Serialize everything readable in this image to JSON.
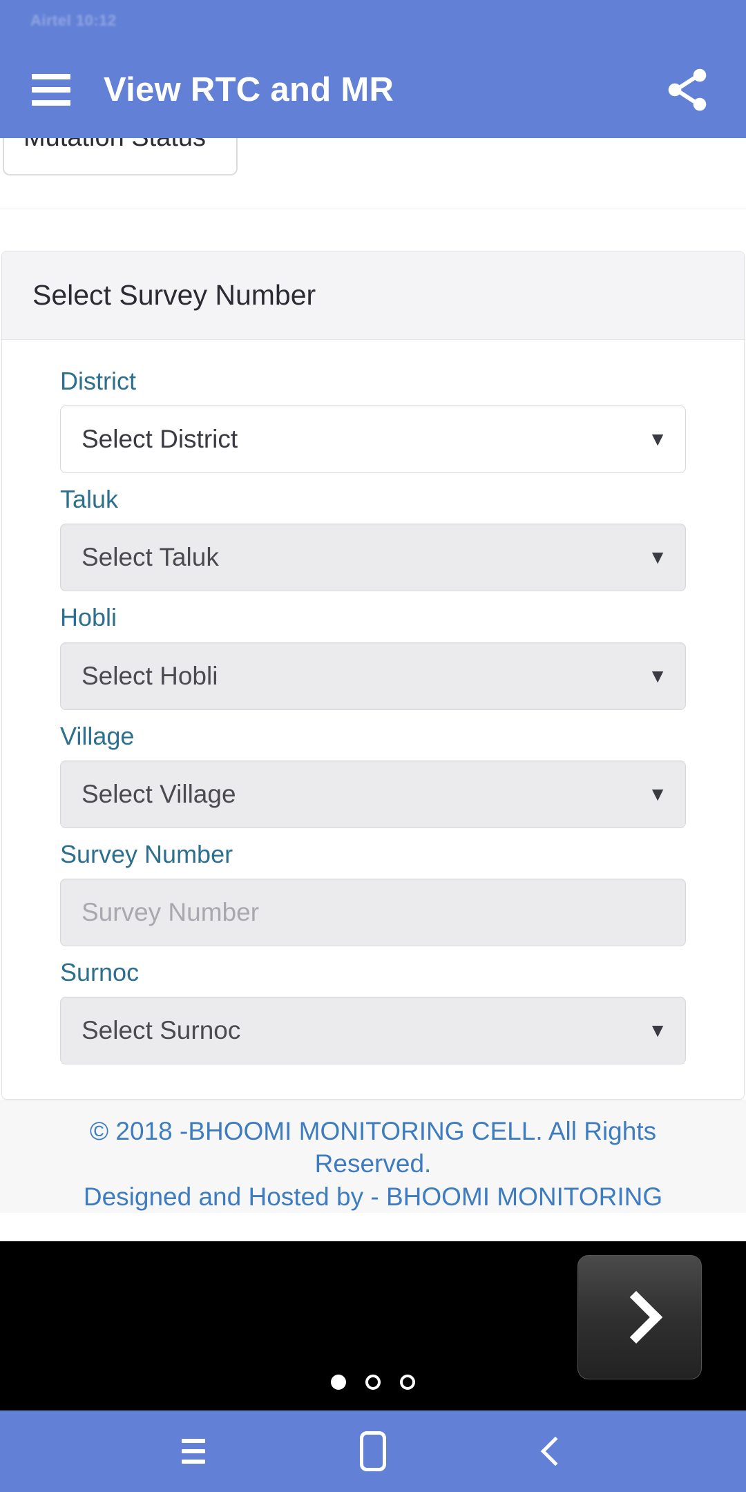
{
  "statusbar": {
    "text": "Airtel  10:12"
  },
  "appbar": {
    "title": "View RTC and MR",
    "menu_icon": "hamburger-menu-icon",
    "share_icon": "share-icon"
  },
  "clipped_above": {
    "label": "Mutation Status"
  },
  "card": {
    "header_title": "Select Survey Number",
    "fields": [
      {
        "label": "District",
        "value": "Select District",
        "type": "select",
        "state": "enabled",
        "name": "district"
      },
      {
        "label": "Taluk",
        "value": "Select Taluk",
        "type": "select",
        "state": "disabled",
        "name": "taluk"
      },
      {
        "label": "Hobli",
        "value": "Select Hobli",
        "type": "select",
        "state": "disabled",
        "name": "hobli"
      },
      {
        "label": "Village",
        "value": "Select Village",
        "type": "select",
        "state": "disabled",
        "name": "village"
      },
      {
        "label": "Survey Number",
        "value": "",
        "placeholder": "Survey Number",
        "type": "text",
        "state": "disabled",
        "name": "survey-number"
      },
      {
        "label": "Surnoc",
        "value": "Select Surnoc",
        "type": "select",
        "state": "disabled",
        "name": "surnoc"
      }
    ],
    "caret_glyph": "▼"
  },
  "footer": {
    "line1": "© 2018 -BHOOMI MONITORING CELL. All Rights",
    "line2": "Reserved.",
    "line3": "Designed and Hosted by - BHOOMI MONITORING"
  },
  "overlay": {
    "next_label": "›",
    "next_icon": "chevron-right-icon",
    "dots": [
      {
        "active": true
      },
      {
        "active": false
      },
      {
        "active": false
      }
    ]
  },
  "navbar": {
    "recents_icon": "recents-icon",
    "home_icon": "home-icon",
    "back_icon": "back-icon"
  },
  "colors": {
    "accent_blue": "#6280d6",
    "label_teal": "#2c6f8e",
    "footer_link": "#3e7cc0",
    "card_header_bg": "#f4f4f6",
    "disabled_bg": "#ebebed"
  }
}
